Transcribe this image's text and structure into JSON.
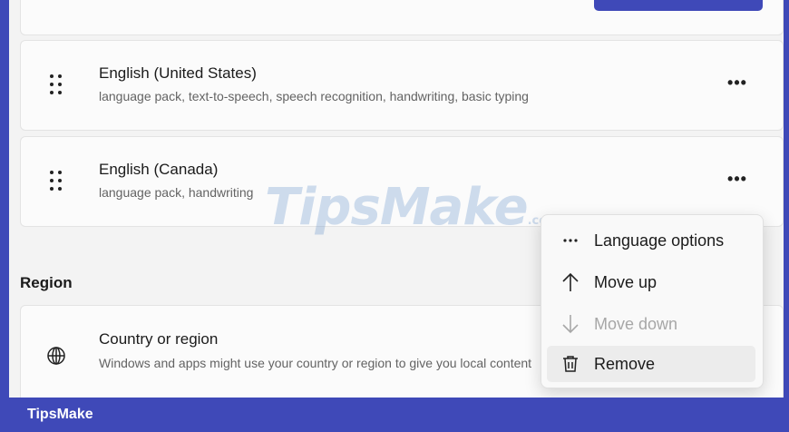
{
  "languages": [
    {
      "name": "English (United States)",
      "features": "language pack, text-to-speech, speech recognition, handwriting, basic typing"
    },
    {
      "name": "English (Canada)",
      "features": "language pack, handwriting"
    }
  ],
  "more_button": "•••",
  "region": {
    "section_title": "Region",
    "country": {
      "title": "Country or region",
      "description": "Windows and apps might use your country or region to give you local content"
    }
  },
  "context_menu": {
    "items": [
      {
        "label": "Language options",
        "icon": "more-icon",
        "enabled": true
      },
      {
        "label": "Move up",
        "icon": "arrow-up-icon",
        "enabled": true
      },
      {
        "label": "Move down",
        "icon": "arrow-down-icon",
        "enabled": false
      },
      {
        "label": "Remove",
        "icon": "trash-icon",
        "enabled": true,
        "highlighted": true
      }
    ]
  },
  "watermark": {
    "text": "TipsMake",
    "suffix": ".com"
  },
  "footer": {
    "label": "TipsMake"
  },
  "colors": {
    "accent": "#3f49b8",
    "background": "#f3f3f3",
    "card": "#fbfbfb"
  }
}
